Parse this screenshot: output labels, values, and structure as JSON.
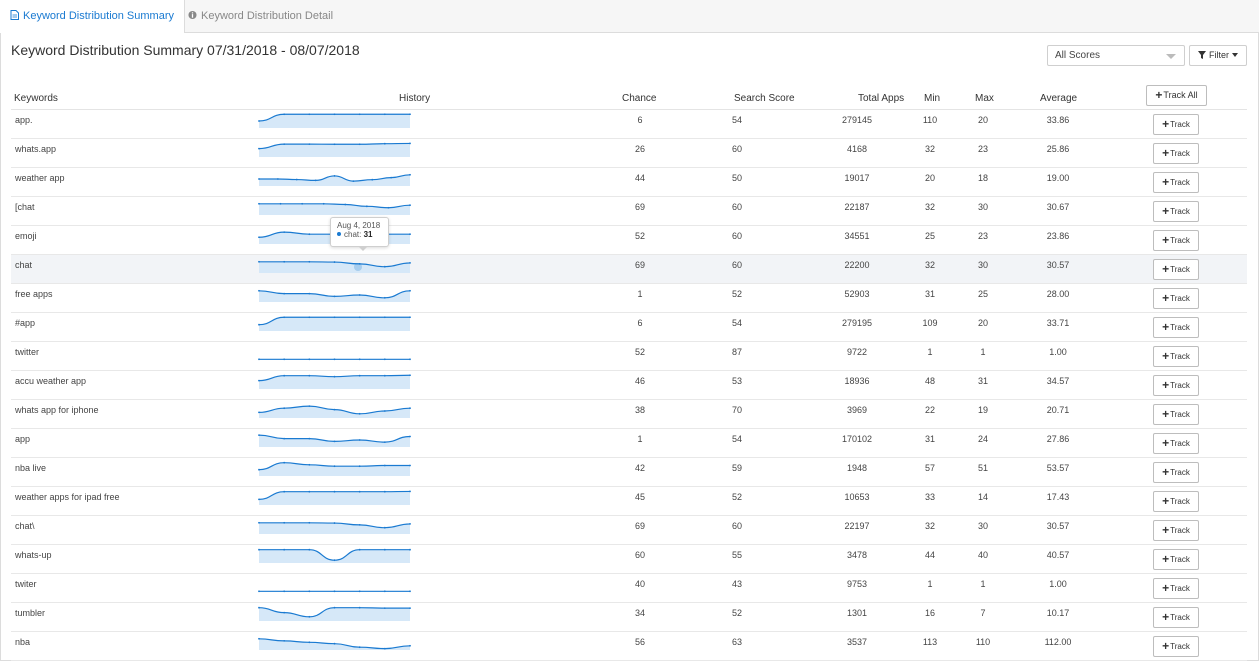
{
  "tabs": [
    {
      "label": "Keyword Distribution Summary",
      "active": true,
      "icon": "document-icon"
    },
    {
      "label": "Keyword Distribution Detail",
      "active": false,
      "icon": "info-icon"
    }
  ],
  "page_title": "Keyword Distribution Summary 07/31/2018 - 08/07/2018",
  "controls": {
    "scores_select": "All Scores",
    "filter_label": "Filter",
    "track_all_label": "Track All"
  },
  "columns": {
    "keywords": "Keywords",
    "history": "History",
    "chance": "Chance",
    "search_score": "Search Score",
    "total_apps": "Total Apps",
    "min": "Min",
    "max": "Max",
    "average": "Average"
  },
  "track_label": "Track",
  "tooltip": {
    "date": "Aug 4, 2018",
    "series": "chat:",
    "value": "31"
  },
  "colors": {
    "accent": "#1a7ad1",
    "spark_fill": "#d6e8f8",
    "highlight_row": "#f2f4f7"
  },
  "rows": [
    {
      "keyword": "app.",
      "chance": "6",
      "search_score": "54",
      "total_apps": "279145",
      "min": "110",
      "max": "20",
      "average": "33.86",
      "history": [
        50,
        98,
        98,
        98,
        98,
        98,
        98
      ]
    },
    {
      "keyword": "whats.app",
      "chance": "26",
      "search_score": "60",
      "total_apps": "4168",
      "min": "32",
      "max": "23",
      "average": "25.86",
      "history": [
        60,
        92,
        92,
        91,
        91,
        95,
        97
      ]
    },
    {
      "keyword": "weather app",
      "chance": "44",
      "search_score": "50",
      "total_apps": "19017",
      "min": "20",
      "max": "18",
      "average": "19.00",
      "history": [
        50,
        50,
        46,
        40,
        72,
        35,
        45,
        60,
        80
      ]
    },
    {
      "keyword": "[chat",
      "chance": "69",
      "search_score": "60",
      "total_apps": "22187",
      "min": "32",
      "max": "30",
      "average": "30.67",
      "history": [
        80,
        80,
        80,
        80,
        75,
        62,
        52,
        70
      ]
    },
    {
      "keyword": "emoji",
      "chance": "52",
      "search_score": "60",
      "total_apps": "34551",
      "min": "25",
      "max": "23",
      "average": "23.86",
      "history": [
        48,
        85,
        70,
        70,
        70,
        70,
        70
      ]
    },
    {
      "keyword": " chat",
      "chance": "69",
      "search_score": "60",
      "total_apps": "22200",
      "min": "32",
      "max": "30",
      "average": "30.57",
      "highlight": true,
      "history": [
        80,
        80,
        80,
        78,
        65,
        45,
        72
      ]
    },
    {
      "keyword": "free apps",
      "chance": "1",
      "search_score": "52",
      "total_apps": "52903",
      "min": "31",
      "max": "25",
      "average": "28.00",
      "history": [
        80,
        60,
        60,
        40,
        50,
        30,
        80
      ]
    },
    {
      "keyword": "#app",
      "chance": "6",
      "search_score": "54",
      "total_apps": "279195",
      "min": "109",
      "max": "20",
      "average": "33.71",
      "history": [
        45,
        98,
        98,
        98,
        98,
        98,
        98
      ]
    },
    {
      "keyword": "twitter",
      "chance": "52",
      "search_score": "87",
      "total_apps": "9722",
      "min": "1",
      "max": "1",
      "average": "1.00",
      "history": [
        5,
        5,
        5,
        5,
        5,
        5,
        5
      ]
    },
    {
      "keyword": "accu weather app",
      "chance": "46",
      "search_score": "53",
      "total_apps": "18936",
      "min": "48",
      "max": "31",
      "average": "34.57",
      "history": [
        60,
        95,
        95,
        88,
        95,
        95,
        98
      ]
    },
    {
      "keyword": "whats app for iphone",
      "chance": "38",
      "search_score": "70",
      "total_apps": "3969",
      "min": "22",
      "max": "19",
      "average": "20.71",
      "history": [
        40,
        70,
        85,
        60,
        30,
        50,
        70
      ]
    },
    {
      "keyword": "app",
      "chance": "1",
      "search_score": "54",
      "total_apps": "170102",
      "min": "31",
      "max": "24",
      "average": "27.86",
      "history": [
        85,
        60,
        60,
        40,
        50,
        35,
        75
      ]
    },
    {
      "keyword": "nba live",
      "chance": "42",
      "search_score": "59",
      "total_apps": "1948",
      "min": "57",
      "max": "51",
      "average": "53.57",
      "history": [
        45,
        95,
        80,
        70,
        70,
        75,
        75
      ]
    },
    {
      "keyword": "weather apps for ipad free",
      "chance": "45",
      "search_score": "52",
      "total_apps": "10653",
      "min": "33",
      "max": "14",
      "average": "17.43",
      "history": [
        40,
        95,
        95,
        95,
        95,
        95,
        97
      ]
    },
    {
      "keyword": "chat\\",
      "chance": "69",
      "search_score": "60",
      "total_apps": "22197",
      "min": "32",
      "max": "30",
      "average": "30.57",
      "history": [
        80,
        80,
        80,
        78,
        65,
        45,
        72
      ]
    },
    {
      "keyword": "whats-up",
      "chance": "60",
      "search_score": "55",
      "total_apps": "3478",
      "min": "44",
      "max": "40",
      "average": "40.57",
      "history": [
        95,
        95,
        95,
        20,
        95,
        95,
        95
      ]
    },
    {
      "keyword": "twiter",
      "chance": "40",
      "search_score": "43",
      "total_apps": "9753",
      "min": "1",
      "max": "1",
      "average": "1.00",
      "history": [
        5,
        5,
        5,
        5,
        5,
        5,
        5
      ]
    },
    {
      "keyword": "tumbler",
      "chance": "34",
      "search_score": "52",
      "total_apps": "1301",
      "min": "16",
      "max": "7",
      "average": "10.17",
      "history": [
        95,
        60,
        30,
        95,
        95,
        92,
        92
      ]
    },
    {
      "keyword": "nba",
      "chance": "56",
      "search_score": "63",
      "total_apps": "3537",
      "min": "113",
      "max": "110",
      "average": "112.00",
      "history": [
        80,
        65,
        55,
        45,
        20,
        10,
        30
      ]
    }
  ]
}
